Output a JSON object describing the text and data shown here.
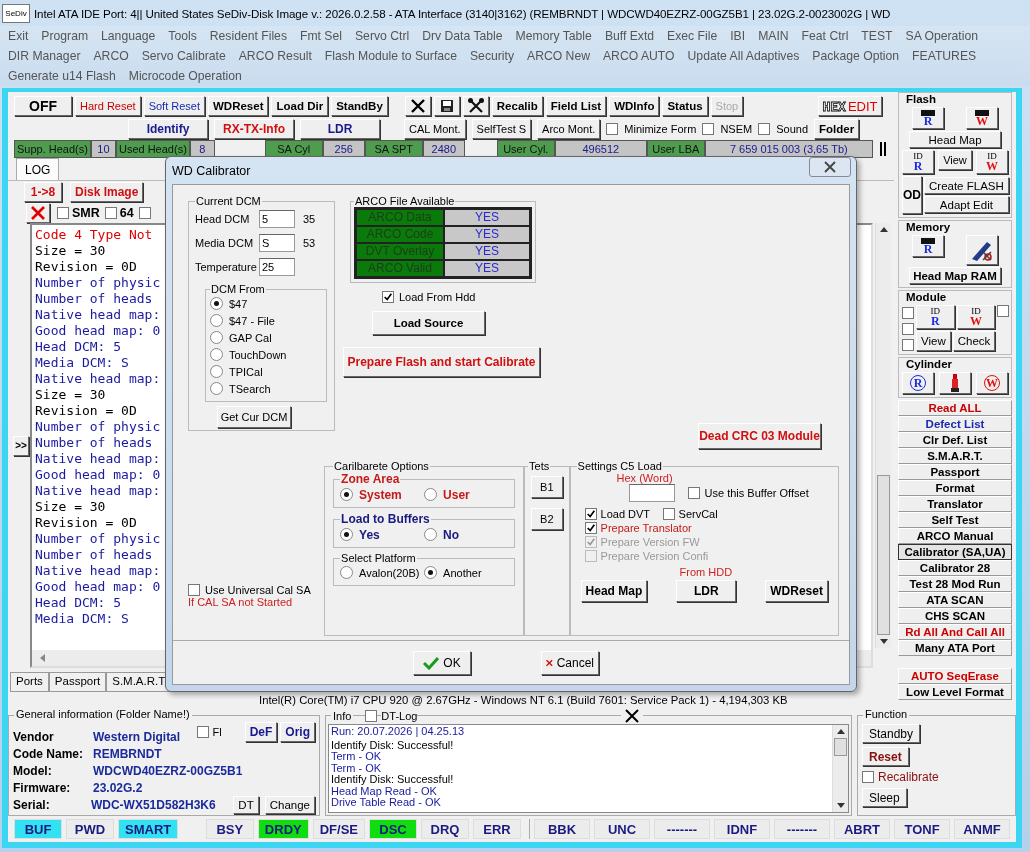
{
  "window": {
    "app_icon": "SeDiv",
    "title": "Intel ATA IDE  Port: 4|| United States  SeDiv-Disk Image v.: 2026.0.2.58 - ATA Interface (3140|3162)  (REMBRNDT | WDCWD40EZRZ-00GZ5B1 | 23.02G.2-0023002G | WD"
  },
  "menu": [
    [
      "Exit",
      "Program",
      "Language",
      "Tools",
      "Resident Files",
      "Fmt Sel",
      "Servo Ctrl",
      "Drv Data Table",
      "Memory Table",
      "Buff Extd",
      "Exec File",
      "IBI",
      "MAIN",
      "Feat Ctrl",
      "TEST",
      "SA Operation"
    ],
    [
      "DIR Manager",
      "ARCO",
      "Servo Calibrate",
      "ARCO Result",
      "Flash Module to Surface",
      "Security",
      "ARCO New",
      "ARCO AUTO",
      "Update All Adaptives",
      "Package Option",
      "FEATURES"
    ],
    [
      "Generate u14 Flash",
      "Microcode Operation"
    ]
  ],
  "toolbar": {
    "buttons_left": [
      {
        "label": "OFF",
        "kind": "big"
      },
      {
        "label": "Hard Reset",
        "kind": "red"
      },
      {
        "label": "Soft Reset",
        "kind": "blue"
      },
      {
        "label": "WDReset",
        "kind": "bold"
      },
      {
        "label": "Load Dir",
        "kind": "bold"
      },
      {
        "label": "StandBy",
        "kind": "bold"
      }
    ],
    "buttons_right": [
      {
        "label": "Recalib",
        "kind": "bold",
        "disabled": false
      },
      {
        "label": "Field List",
        "kind": "bold",
        "disabled": false
      },
      {
        "label": "WDInfo",
        "kind": "bold",
        "disabled": false
      },
      {
        "label": "Status",
        "kind": "bold",
        "disabled": false
      },
      {
        "label": "Stop",
        "kind": "plain",
        "disabled": true
      }
    ],
    "hex_edit": [
      "HEX",
      "EDIT"
    ]
  },
  "toolbar2": {
    "buttons": [
      {
        "label": "Identify",
        "kind": "navy"
      },
      {
        "label": "RX-TX-Info",
        "kind": "redbold"
      },
      {
        "label": "LDR",
        "kind": "navy"
      },
      {
        "label": "CAL Mont.",
        "kind": "plain"
      },
      {
        "label": "SelfTest S",
        "kind": "plain"
      },
      {
        "label": "Arco Mont.",
        "kind": "plain"
      }
    ],
    "checks": [
      {
        "label": "Minimize Form",
        "checked": false
      },
      {
        "label": "NSEM",
        "checked": false
      },
      {
        "label": "Sound",
        "checked": false
      }
    ],
    "folder": "Folder"
  },
  "drive_bar": [
    [
      {
        "label": "Supp. Head(s)",
        "value": "10"
      },
      {
        "label": "Used Head(s)",
        "value": "8"
      }
    ],
    [
      {
        "label": "SA Cyl",
        "value": "256"
      },
      {
        "label": "SA SPT",
        "value": "2480"
      }
    ],
    [
      {
        "label": "User Cyl.",
        "value": "496512"
      },
      {
        "label": "User LBA",
        "value": "7 659 015 003  (3,65 Tb)"
      }
    ]
  ],
  "log_tabs": [
    {
      "label": "LOG",
      "selected": true
    }
  ],
  "log_buttons": [
    "1->8",
    "Disk Image"
  ],
  "log_checks": [
    {
      "label": "SMR",
      "checked": false
    },
    {
      "label": "64",
      "checked": false
    },
    {
      "checked": false
    }
  ],
  "log_expand": ">>",
  "log": [
    {
      "text": "Code 4 Type Not",
      "color": "#e00000"
    },
    {
      "text": "Size = 30",
      "color": "#000000"
    },
    {
      "text": "Revision = 0D",
      "color": "#000000"
    },
    {
      "text": "Number of physic",
      "color": "#1a1aa0"
    },
    {
      "text": "Number of heads",
      "color": "#1a1aa0"
    },
    {
      "text": "Native head map:",
      "color": "#1a1aa0"
    },
    {
      "text": "Good head map: 0",
      "color": "#1a1aa0"
    },
    {
      "text": "Head DCM: 5",
      "color": "#1a1aa0"
    },
    {
      "text": "Media DCM: S",
      "color": "#1a1aa0"
    },
    {
      "text": "Native head map:",
      "color": "#1a1aa0"
    },
    {
      "text": "Size = 30",
      "color": "#000000"
    },
    {
      "text": "Revision = 0D",
      "color": "#000000"
    },
    {
      "text": "Number of physic",
      "color": "#1a1aa0"
    },
    {
      "text": "Number of heads",
      "color": "#1a1aa0"
    },
    {
      "text": "Native head map:",
      "color": "#1a1aa0"
    },
    {
      "text": "Good head map: 0",
      "color": "#1a1aa0"
    },
    {
      "text": "Native head map:",
      "color": "#1a1aa0"
    },
    {
      "text": "Size = 30",
      "color": "#000000"
    },
    {
      "text": "Revision = 0D",
      "color": "#000000"
    },
    {
      "text": "Number of physic",
      "color": "#1a1aa0"
    },
    {
      "text": "Number of heads",
      "color": "#1a1aa0"
    },
    {
      "text": "Native head map:",
      "color": "#1a1aa0"
    },
    {
      "text": "Good head map: 0",
      "color": "#1a1aa0"
    },
    {
      "text": "Head DCM: 5",
      "color": "#1a1aa0"
    },
    {
      "text": "Media DCM: S",
      "color": "#1a1aa0"
    }
  ],
  "right_panel": {
    "flash": {
      "title": "Flash",
      "chip_read": "R",
      "chip_write": "W",
      "head_map": "Head Map",
      "id_read": [
        "ID",
        "R"
      ],
      "view": "View",
      "id_write": [
        "ID",
        "W"
      ],
      "od": "OD",
      "create": "Create FLASH",
      "adapt": "Adapt Edit"
    },
    "memory": {
      "title": "Memory",
      "chip_read": "R",
      "head_map_ram": "Head Map RAM"
    },
    "module": {
      "title": "Module",
      "checks": [
        {
          "checked": false
        },
        {
          "checked": false
        },
        {
          "checked": false
        },
        {
          "checked": false
        }
      ],
      "id_read": [
        "ID",
        "R"
      ],
      "id_write": [
        "ID",
        "W"
      ],
      "view": "View",
      "check": "Check"
    },
    "cylinder": {
      "title": "Cylinder",
      "read": "R",
      "write": "W"
    },
    "buttons": [
      {
        "label": "Read ALL",
        "kind": "red",
        "selected": false
      },
      {
        "label": "Defect List",
        "kind": "blue",
        "selected": false
      },
      {
        "label": "Clr Def. List",
        "kind": "plain",
        "selected": false
      },
      {
        "label": "S.M.A.R.T.",
        "kind": "plain",
        "selected": false
      },
      {
        "label": "Passport",
        "kind": "plain",
        "selected": false
      },
      {
        "label": "Format",
        "kind": "plain",
        "selected": false
      },
      {
        "label": "Translator",
        "kind": "plain",
        "selected": false
      },
      {
        "label": "Self Test",
        "kind": "plain",
        "selected": false
      },
      {
        "label": "ARCO Manual",
        "kind": "plain",
        "selected": false
      },
      {
        "label": "Calibrator (SA,UA)",
        "kind": "plain",
        "selected": true
      },
      {
        "label": "Calibrator 28",
        "kind": "plain",
        "selected": false
      },
      {
        "label": "Test 28 Mod Run",
        "kind": "plain",
        "selected": false
      },
      {
        "label": "ATA SCAN",
        "kind": "plain",
        "selected": false
      },
      {
        "label": "CHS SCAN",
        "kind": "plain",
        "selected": false
      },
      {
        "label": "Rd All And Call All",
        "kind": "red",
        "selected": false
      },
      {
        "label": "Many ATA Port",
        "kind": "plain",
        "selected": false
      }
    ],
    "buttons_bottom": [
      {
        "label": "AUTO SeqErase",
        "kind": "red",
        "selected": false
      },
      {
        "label": "Low Level Format",
        "kind": "plain",
        "selected": false
      }
    ]
  },
  "bottom_tabs": [
    {
      "label": "Ports",
      "selected": false
    },
    {
      "label": "Passport",
      "selected": false
    },
    {
      "label": "S.M.A.R.T.",
      "selected": false
    }
  ],
  "system_info": "Intel(R) Core(TM) i7 CPU 920  @ 2.67GHz - Windows NT 6.1 (Build 7601: Service Pack 1) -  4,194,303 KB",
  "general_info": {
    "title": "General information (Folder Name!)",
    "fl": {
      "label": "Fl",
      "checked": false
    },
    "buttons": [
      "DeF",
      "Orig"
    ],
    "rows": [
      {
        "label": "Vendor",
        "value": "Western Digital"
      },
      {
        "label": "Code Name:",
        "value": "REMBRNDT"
      },
      {
        "label": "Model:",
        "value": "WDCWD40EZRZ-00GZ5B1"
      },
      {
        "label": "Firmware:",
        "value": "23.02G.2"
      },
      {
        "label": "Serial:",
        "value": "WDC-WX51D582H3K6"
      }
    ],
    "row_buttons": [
      "DT",
      "Change"
    ]
  },
  "info": {
    "title": "Info",
    "dt_log": {
      "label": "DT-Log",
      "checked": false
    },
    "lines": [
      {
        "text": "Run: 20.07.2026 | 04.25.13",
        "color": "#1a1aa0"
      },
      {
        "text": "Identify Disk: Successful!",
        "color": "#000000"
      },
      {
        "text": "Term - OK",
        "color": "#1a1aa0"
      },
      {
        "text": "Term - OK",
        "color": "#1a1aa0"
      },
      {
        "text": "Identify Disk: Successful!",
        "color": "#000000"
      },
      {
        "text": "Head Map Read - OK",
        "color": "#1a1aa0"
      },
      {
        "text": "Drive Table Read - OK",
        "color": "#1a1aa0"
      }
    ]
  },
  "function": {
    "title": "Function",
    "standby": "Standby",
    "reset": "Reset",
    "recalibrate": {
      "label": "Recalibrate",
      "checked": false
    },
    "sleep": "Sleep"
  },
  "status_flags": [
    [
      {
        "label": "BUF",
        "color": "#33e2f2"
      },
      {
        "label": "PWD",
        "color": "#ececec"
      },
      {
        "label": "SMART",
        "color": "#33e2f2"
      }
    ],
    [
      {
        "label": "BSY",
        "color": "#ececec"
      },
      {
        "label": "DRDY",
        "color": "#10dd10"
      },
      {
        "label": "DF/SE",
        "color": "#ececec"
      },
      {
        "label": "DSC",
        "color": "#10dd10"
      },
      {
        "label": "DRQ",
        "color": "#ececec"
      },
      {
        "label": "ERR",
        "color": "#ececec"
      }
    ],
    [
      {
        "label": "BBK",
        "color": "#ececec"
      },
      {
        "label": "UNC",
        "color": "#ececec"
      },
      {
        "label": "-------",
        "color": "#ececec"
      },
      {
        "label": "IDNF",
        "color": "#ececec"
      },
      {
        "label": "-------",
        "color": "#ececec"
      },
      {
        "label": "ABRT",
        "color": "#ececec"
      },
      {
        "label": "TONF",
        "color": "#ececec"
      },
      {
        "label": "ANMF",
        "color": "#ececec"
      }
    ]
  ],
  "dialog": {
    "title": "WD Calibrator",
    "current_dcm": {
      "title": "Current DCM",
      "fields": [
        {
          "label": "Head DCM",
          "value": "5",
          "note": "35"
        },
        {
          "label": "Media DCM",
          "value": "S",
          "note": "53"
        },
        {
          "label": "Temperature",
          "value": "25"
        }
      ],
      "dcm_from": {
        "title": "DCM From",
        "options": [
          {
            "label": "$47",
            "selected": true
          },
          {
            "label": "$47 - File",
            "selected": false
          },
          {
            "label": "GAP Cal",
            "selected": false
          },
          {
            "label": "TouchDown",
            "selected": false
          },
          {
            "label": "TPICal",
            "selected": false
          },
          {
            "label": "TSearch",
            "selected": false
          }
        ]
      },
      "get_button": "Get Cur DCM"
    },
    "arco": {
      "title": "ARCO File Available",
      "rows": [
        {
          "label": "ARCO Data",
          "value": "YES"
        },
        {
          "label": "ARCO Code",
          "value": "YES"
        },
        {
          "label": "DVT Overlay",
          "value": "YES"
        },
        {
          "label": "ARCO Valid",
          "value": "YES"
        }
      ]
    },
    "load_from_hdd": {
      "label": "Load From Hdd",
      "checked": true
    },
    "load_source": "Load Source",
    "prepare": "Prepare Flash and start Calibrate",
    "dead_crc": "Dead CRC 03 Module",
    "universal": {
      "label": "Use Universal Cal SA",
      "checked": false,
      "note": "If CAL SA not Started"
    },
    "options": {
      "title": "Carilbarete Options",
      "groups": [
        {
          "title": "Zone Area",
          "kind": "red",
          "options": [
            {
              "label": "System",
              "selected": true
            },
            {
              "label": "User",
              "selected": false
            }
          ]
        },
        {
          "title": "Load to Buffers",
          "kind": "navy",
          "options": [
            {
              "label": "Yes",
              "selected": true
            },
            {
              "label": "No",
              "selected": false
            }
          ]
        },
        {
          "title": "Select Platform",
          "kind": "plain",
          "options": [
            {
              "label": "Avalon(20B)",
              "selected": false
            },
            {
              "label": "Another",
              "selected": true
            }
          ]
        }
      ]
    },
    "tets": {
      "title": "Tets",
      "buttons": [
        "B1",
        "B2"
      ]
    },
    "c5": {
      "title": "Settings C5 Load",
      "hex_label": "Hex (Word)",
      "offset": {
        "label": "Use this Buffer Offset",
        "checked": false
      },
      "checks": [
        {
          "label": "Load DVT",
          "checked": true,
          "disabled": false,
          "kind": "plain"
        },
        {
          "label": "ServCal",
          "checked": false,
          "disabled": false,
          "kind": "plain"
        },
        {
          "label": "Prepare Translator",
          "checked": true,
          "disabled": false,
          "kind": "red"
        },
        {
          "label": "Prepare Version FW",
          "checked": true,
          "disabled": true,
          "kind": "plain"
        },
        {
          "label": "Prepare Version Confi",
          "checked": false,
          "disabled": true,
          "kind": "plain"
        }
      ],
      "from_hdd": "From HDD",
      "buttons": [
        "Head Map",
        "LDR",
        "WDReset"
      ]
    },
    "ok": "OK",
    "cancel": "Cancel"
  }
}
